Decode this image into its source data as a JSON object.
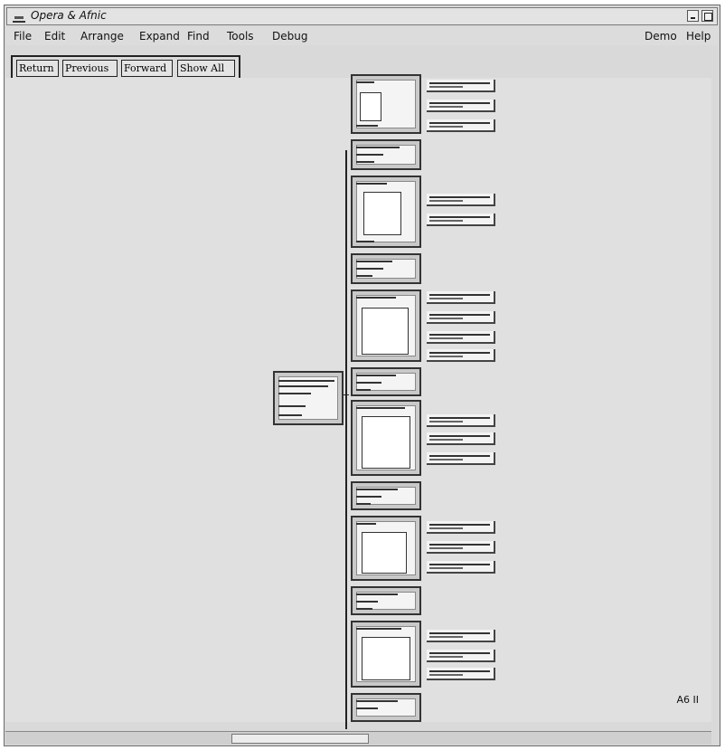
{
  "window": {
    "title": "Opera & Afnic"
  },
  "menubar": {
    "items": [
      "File",
      "Edit",
      "Arrange",
      "Expand",
      "Find",
      "Tools",
      "Debug"
    ],
    "right_items": [
      "Demo",
      "Help"
    ]
  },
  "toolbar": {
    "buttons": [
      "Return",
      "Previous",
      "Forward",
      "Show All"
    ]
  },
  "status": {
    "zoom": "A6 II"
  }
}
